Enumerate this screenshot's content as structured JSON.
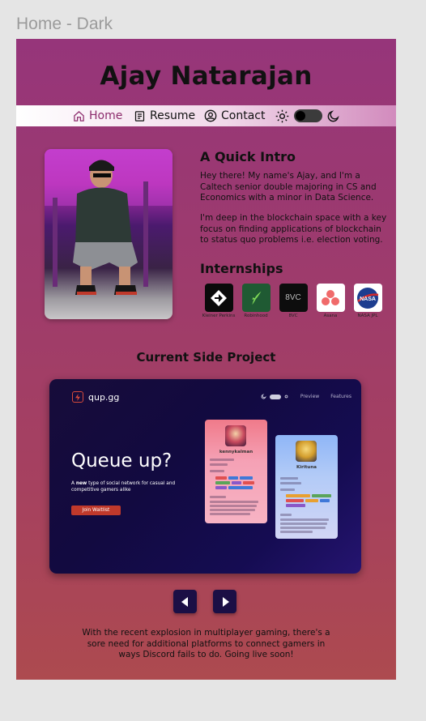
{
  "frame": {
    "label": "Home - Dark"
  },
  "site": {
    "title": "Ajay Natarajan"
  },
  "nav": {
    "home": "Home",
    "resume": "Resume",
    "contact": "Contact",
    "icons": [
      "home-icon",
      "document-icon",
      "user-icon",
      "sun-icon",
      "moon-icon"
    ],
    "active_color": "#8c2b6c"
  },
  "intro": {
    "heading": "A Quick Intro",
    "p1": "Hey there! My name's Ajay, and I'm a Caltech senior double majoring in CS and Economics with a minor in Data Science.",
    "p2": "I'm deep in the blockchain space with a key focus on finding applications of blockchain to status quo problems i.e. election voting."
  },
  "internships": {
    "heading": "Internships",
    "items": [
      {
        "name": "Kleiner Perkins",
        "bg": "#0a0a0a"
      },
      {
        "name": "Robinhood",
        "bg": "#1f5a33"
      },
      {
        "name": "8VC",
        "bg": "#0d0d0d",
        "logo_text": "8VC"
      },
      {
        "name": "Asana",
        "bg": "#ffffff"
      },
      {
        "name": "NASA JPL",
        "bg": "#ffffff",
        "logo_text": "NASA"
      }
    ]
  },
  "project": {
    "heading": "Current Side Project",
    "card": {
      "brand": "qup.gg",
      "nav_preview": "Preview",
      "nav_features": "Features",
      "headline": "Queue up?",
      "sub_pre": "A ",
      "sub_bold": "new",
      "sub_post": " type of social network for casual and competitive gamers alike",
      "cta": "Join Waitlist",
      "profile_a": "kennykalman",
      "profile_b": "Kirituna"
    },
    "description": "With the recent explosion in multiplayer gaming, there's a sore need for additional platforms to connect gamers in ways Discord fails to do. Going live soon!"
  },
  "colors": {
    "page_top": "#96357a",
    "page_bottom": "#ad4a4f",
    "card_bg": "#150c52",
    "accent": "#c0392b"
  }
}
